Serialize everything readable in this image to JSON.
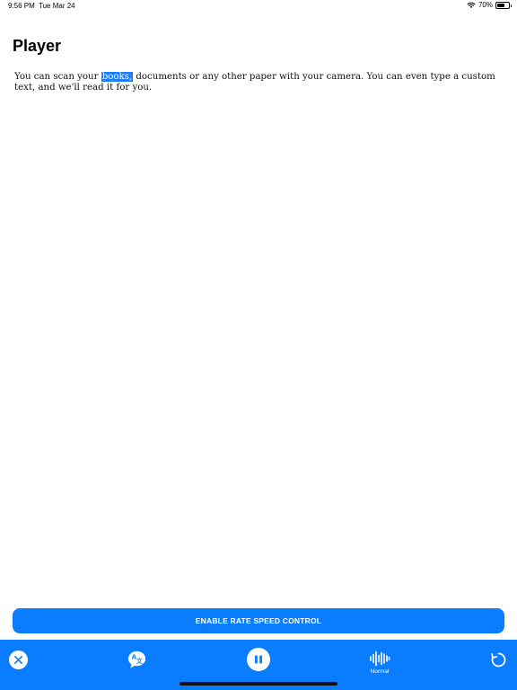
{
  "status_bar": {
    "time": "9:56 PM",
    "date": "Tue Mar 24",
    "battery": "70%",
    "battery_level": 0.7
  },
  "page": {
    "title": "Player",
    "text_before": "You can scan your ",
    "text_highlight": "books,",
    "text_after": " documents or any other paper with your camera. You can even type a custom text, and we'll read it for you."
  },
  "rate_button": {
    "label": "ENABLE RATE SPEED CONTROL"
  },
  "toolbar": {
    "voice_label": "Normal",
    "icons": [
      "close-icon",
      "translate-icon",
      "pause-icon",
      "waveform-icon",
      "refresh-icon"
    ]
  },
  "colors": {
    "accent": "#0a7cff",
    "highlight": "#1f7ef7"
  }
}
